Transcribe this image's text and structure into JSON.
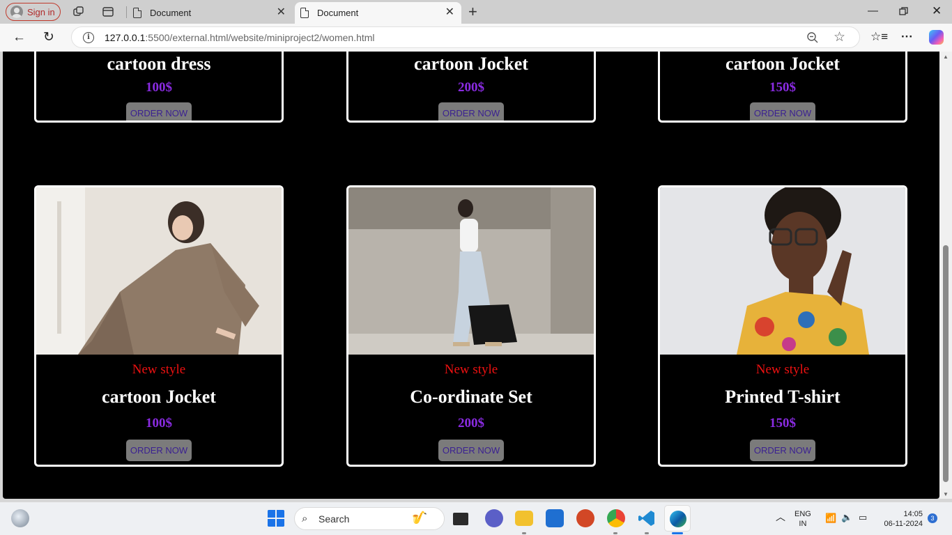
{
  "browser": {
    "signin_label": "Sign in",
    "tabs": [
      {
        "title": "Document",
        "active": false
      },
      {
        "title": "Document",
        "active": true
      }
    ],
    "url_host": "127.0.0.1",
    "url_path": ":5500/external.html/website/miniproject2/women.html"
  },
  "page": {
    "top_row": [
      {
        "name": "cartoon dress",
        "price": "100$",
        "button": "ORDER NOW"
      },
      {
        "name": "cartoon Jocket",
        "price": "200$",
        "button": "ORDER NOW"
      },
      {
        "name": "cartoon Jocket",
        "price": "150$",
        "button": "ORDER NOW"
      }
    ],
    "bottom_row": [
      {
        "tag": "New style",
        "name": "cartoon Jocket",
        "price": "100$",
        "button": "ORDER NOW",
        "photo": "woman-in-brown-suit"
      },
      {
        "tag": "New style",
        "name": "Co-ordinate Set",
        "price": "200$",
        "button": "ORDER NOW",
        "photo": "woman-walking-street"
      },
      {
        "tag": "New style",
        "name": "Printed T-shirt",
        "price": "150$",
        "button": "ORDER NOW",
        "photo": "woman-with-glasses"
      }
    ],
    "colors": {
      "tag": "#ee1111",
      "price": "#8a2be2",
      "button_bg": "#7b7b7b",
      "button_text": "#3b2191"
    }
  },
  "taskbar": {
    "search_placeholder": "Search",
    "lang_top": "ENG",
    "lang_bottom": "IN",
    "time": "14:05",
    "date": "06-11-2024",
    "notification_count": "3"
  }
}
